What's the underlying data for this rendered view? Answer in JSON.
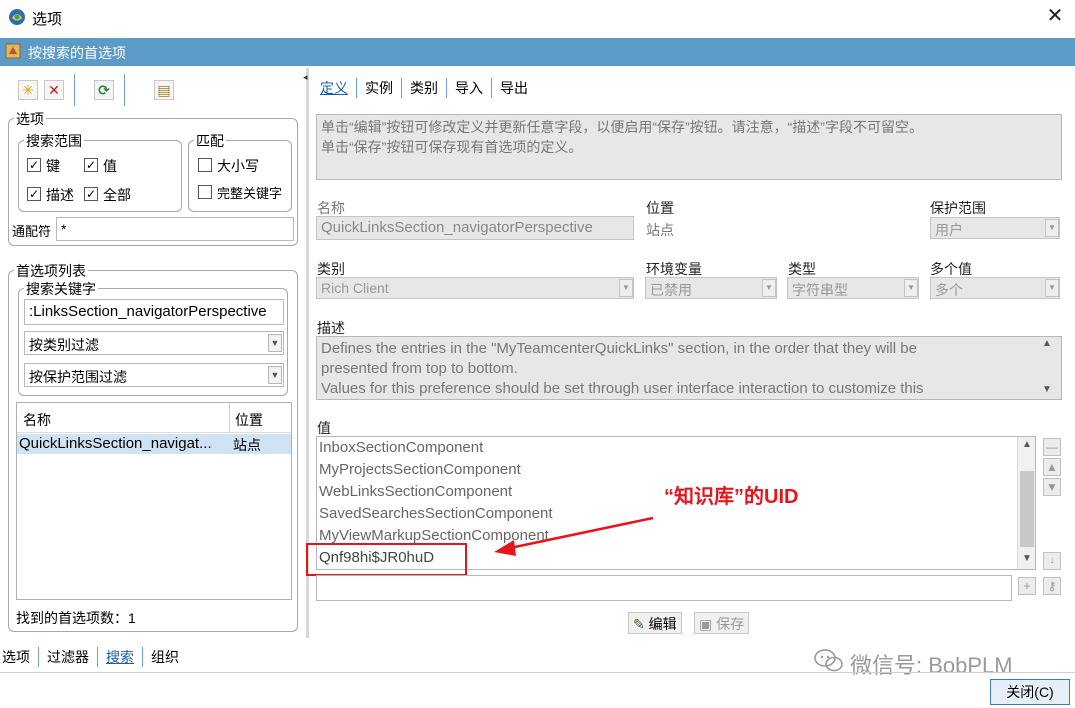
{
  "window": {
    "title": "选项",
    "close_glyph": "✕"
  },
  "header": {
    "title": "按搜索的首选项"
  },
  "toolbar": {
    "new_glyph": "✳",
    "delete_glyph": "✕",
    "refresh_glyph": "⟳",
    "report_glyph": "▤"
  },
  "options": {
    "legend": "选项",
    "scope": {
      "legend": "搜索范围",
      "key_label": "键",
      "key_checked": "✓",
      "value_label": "值",
      "value_checked": "✓",
      "desc_label": "描述",
      "desc_checked": "✓",
      "all_label": "全部",
      "all_checked": "✓"
    },
    "match": {
      "legend": "匹配",
      "case_label": "大小写",
      "whole_label": "完整关键字"
    },
    "wildcard_label": "通配符",
    "wildcard_value": "*"
  },
  "pref_list": {
    "legend": "首选项列表",
    "search_key_legend": "搜索关键字",
    "search_key_value": ":LinksSection_navigatorPerspective",
    "filter_category": "按类别过滤",
    "filter_protection": "按保护范围过滤",
    "columns": [
      "名称",
      "位置"
    ],
    "rows": [
      {
        "name": "QuickLinksSection_navigat...",
        "location": "站点"
      }
    ],
    "found_count_text": "找到的首选项数：1"
  },
  "bottom_tabs": [
    "选项",
    "过滤器",
    "搜索",
    "组织"
  ],
  "right": {
    "tabs": [
      "定义",
      "实例",
      "类别",
      "导入",
      "导出"
    ],
    "info_text_1": "单击“编辑”按钮可修改定义并更新任意字段，以便启用“保存”按钮。请注意，“描述”字段不可留空。",
    "info_text_2": "单击“保存”按钮可保存现有首选项的定义。",
    "name_label": "名称",
    "name_value": "QuickLinksSection_navigatorPerspective",
    "location_label": "位置",
    "location_value": "站点",
    "protection_label": "保护范围",
    "protection_value": "用户",
    "category_label": "类别",
    "category_value": "Rich Client",
    "env_label": "环境变量",
    "env_value": "已禁用",
    "type_label": "类型",
    "type_value": "字符串型",
    "multi_label": "多个值",
    "multi_value": "多个",
    "desc_label": "描述",
    "desc_line_1": "Defines the entries in the \"MyTeamcenterQuickLinks\" section, in the order that they will be",
    "desc_line_2": "presented from top to bottom.",
    "desc_line_3": "Values for this preference should be set through user interface interaction to customize this",
    "values_label": "值",
    "values": [
      "InboxSectionComponent",
      "MyProjectsSectionComponent",
      "WebLinksSectionComponent",
      "SavedSearchesSectionComponent",
      "MyViewMarkupSectionComponent",
      "Qnf98hi$JR0huD"
    ],
    "edit_label": "编辑",
    "save_label": "保存"
  },
  "annotation": {
    "text": "“知识库”的UID",
    "color": "#e8141b"
  },
  "watermark": "微信号: BobPLM",
  "close_button": "关闭(C)",
  "colors": {
    "header_blue": "#5b9bc6",
    "accent_blue": "#1a5fa8",
    "annotation_red": "#e8141b"
  }
}
